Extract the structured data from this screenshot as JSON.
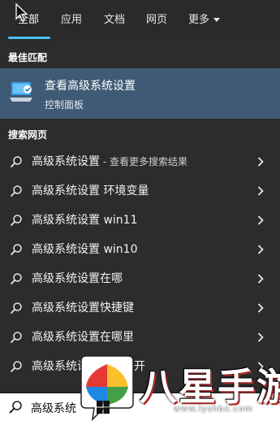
{
  "tabs": [
    {
      "label": "全部",
      "active": true
    },
    {
      "label": "应用",
      "active": false
    },
    {
      "label": "文档",
      "active": false
    },
    {
      "label": "网页",
      "active": false
    },
    {
      "label": "更多",
      "active": false
    }
  ],
  "accent_color": "#4cc2ff",
  "best_match": {
    "header": "最佳匹配",
    "title": "查看高级系统设置",
    "subtitle": "控制面板",
    "icon": "system-settings-icon"
  },
  "web": {
    "header": "搜索网页",
    "results": [
      {
        "label": "高级系统设置",
        "suffix": " - 查看更多搜索结果"
      },
      {
        "label": "高级系统设置 环境变量",
        "suffix": ""
      },
      {
        "label": "高级系统设置 win11",
        "suffix": ""
      },
      {
        "label": "高级系统设置 win10",
        "suffix": ""
      },
      {
        "label": "高级系统设置在哪",
        "suffix": ""
      },
      {
        "label": "高级系统设置快捷键",
        "suffix": ""
      },
      {
        "label": "高级系统设置在哪里",
        "suffix": ""
      },
      {
        "label": "高级系统设置怎么打开",
        "suffix": ""
      }
    ]
  },
  "search": {
    "value": "高级系统"
  },
  "watermark": {
    "brand": "八星手游网",
    "domain": "www.lyshbx.com"
  }
}
